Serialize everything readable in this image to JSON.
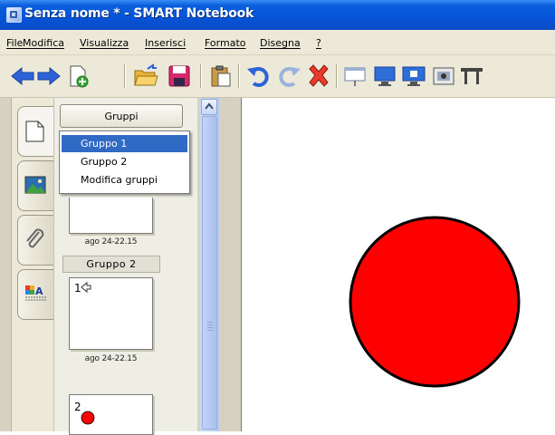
{
  "window": {
    "title": "Senza nome * - SMART Notebook"
  },
  "menu": [
    "File",
    "Modifica",
    "Visualizza",
    "Inserisci",
    "Formato",
    "Disegna",
    "?"
  ],
  "toolbar": {
    "icons": [
      "back-arrow-icon",
      "forward-arrow-icon",
      "add-page-icon",
      "open-folder-icon",
      "save-icon",
      "paste-icon",
      "undo-icon",
      "redo-icon",
      "delete-icon",
      "screen-shade-icon",
      "full-screen-icon",
      "dual-page-icon",
      "capture-icon",
      "table-icon"
    ]
  },
  "sidebar_tabs": [
    "page-sorter-icon",
    "gallery-icon",
    "attachments-icon",
    "properties-icon"
  ],
  "sorter": {
    "groups_button_label": "Gruppi",
    "thumb_caption_1": "ago 24-22.15",
    "group2_label": "Gruppo 2",
    "thumb_caption_2": "ago 24-22.15",
    "page_num_3": "2"
  },
  "dropdown": {
    "items": [
      "Gruppo 1",
      "Gruppo 2",
      "Modifica gruppi"
    ],
    "selected": "Gruppo 1"
  },
  "canvas": {
    "shape": "circle",
    "fill": "#ff0000",
    "stroke": "#000000"
  },
  "colors": {
    "title_bar": "#0653d8",
    "selection": "#316ac5",
    "circle": "#ff0000"
  }
}
